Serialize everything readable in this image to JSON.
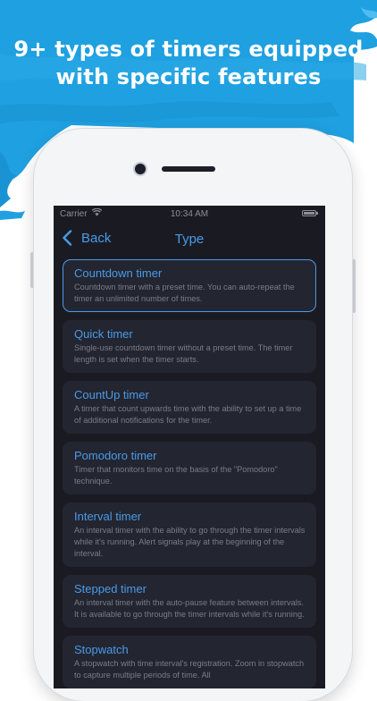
{
  "headline": {
    "line1": "9+ types of timers equipped",
    "line2": "with specific features"
  },
  "colors": {
    "accent": "#4a9be8",
    "brush": "#1fa0e0",
    "screen_bg": "#1a1b22",
    "card_bg": "#232530"
  },
  "statusbar": {
    "carrier": "Carrier",
    "time": "10:34 AM"
  },
  "navbar": {
    "back_label": "Back",
    "title": "Type"
  },
  "timer_types": [
    {
      "title": "Countdown timer",
      "description": "Countdown timer with a preset time. You can auto-repeat the timer an unlimited number of times.",
      "selected": true
    },
    {
      "title": "Quick timer",
      "description": "Single-use countdown timer without a preset time. The timer length is set when the timer starts."
    },
    {
      "title": "CountUp timer",
      "description": "A timer that count upwards time with the ability to set up a time of additional notifications for the timer."
    },
    {
      "title": "Pomodoro timer",
      "description": "Timer that monitors time on the basis of the \"Pomodoro\" technique."
    },
    {
      "title": "Interval timer",
      "description": "An interval timer with the ability to go through the timer intervals while it's running. Alert signals play at the beginning of the interval."
    },
    {
      "title": "Stepped timer",
      "description": "An interval timer with the auto-pause feature between intervals. It is available to go through the timer intervals while it's running."
    },
    {
      "title": "Stopwatch",
      "description": "A stopwatch with time interval's registration. Zoom in stopwatch to capture multiple periods of time. All"
    }
  ]
}
